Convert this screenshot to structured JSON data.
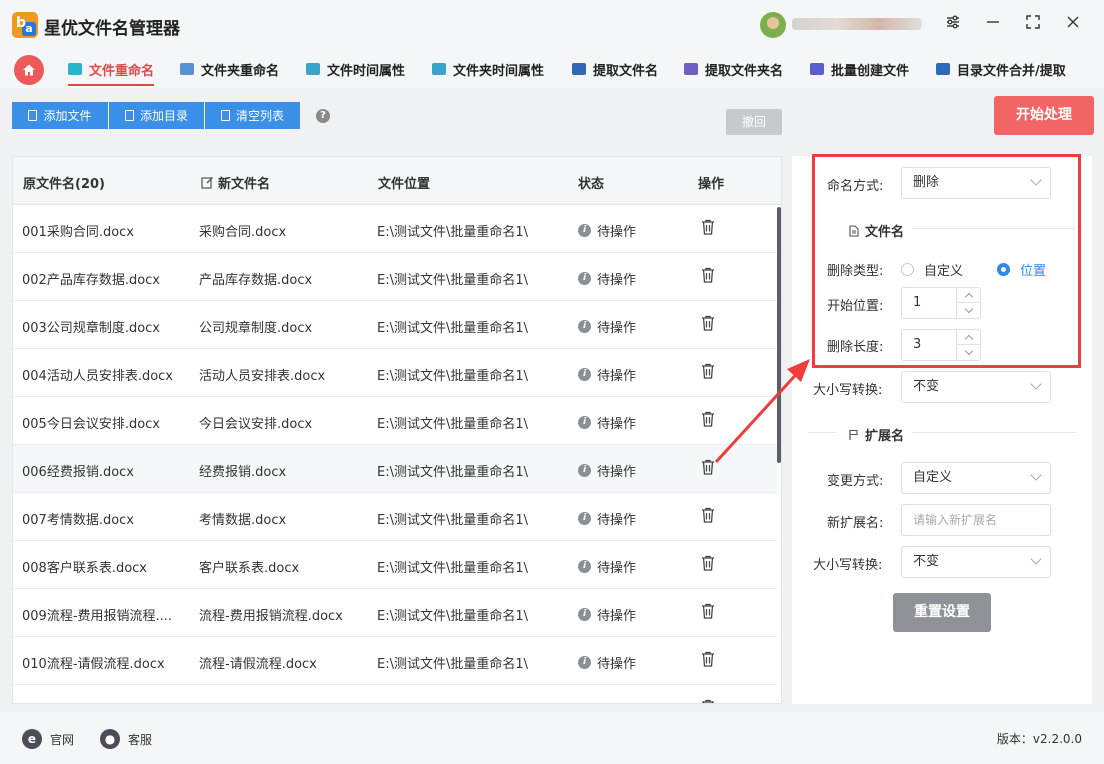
{
  "app": {
    "title": "星优文件名管理器",
    "logo_text": "b",
    "logo_sub": "a"
  },
  "window_controls": {
    "settings": "⚙",
    "minimize": "—",
    "maximize": "⛶",
    "close": "✕"
  },
  "tabs": [
    {
      "label": "文件重命名",
      "active": true,
      "icon_color": "#2ab3c9"
    },
    {
      "label": "文件夹重命名",
      "active": false,
      "icon_color": "#5b8fd6"
    },
    {
      "label": "文件时间属性",
      "active": false,
      "icon_color": "#3aa3c9"
    },
    {
      "label": "文件夹时间属性",
      "active": false,
      "icon_color": "#3aa3c9"
    },
    {
      "label": "提取文件名",
      "active": false,
      "icon_color": "#3567b5"
    },
    {
      "label": "提取文件夹名",
      "active": false,
      "icon_color": "#6d5fc2"
    },
    {
      "label": "批量创建文件",
      "active": false,
      "icon_color": "#5a5fd0"
    },
    {
      "label": "目录文件合并/提取",
      "active": false,
      "icon_color": "#2e6bb8"
    }
  ],
  "toolbar": {
    "add_file": "添加文件",
    "add_dir": "添加目录",
    "clear_list": "清空列表",
    "help": "?",
    "undo": "撤回",
    "start": "开始处理"
  },
  "table": {
    "headers": {
      "original": "原文件名(20)",
      "new": "新文件名",
      "location": "文件位置",
      "status": "状态",
      "action": "操作"
    },
    "rows": [
      {
        "original": "001采购合同.docx",
        "new": "采购合同.docx",
        "location": "E:\\测试文件\\批量重命名1\\",
        "status": "待操作"
      },
      {
        "original": "002产品库存数据.docx",
        "new": "产品库存数据.docx",
        "location": "E:\\测试文件\\批量重命名1\\",
        "status": "待操作"
      },
      {
        "original": "003公司规章制度.docx",
        "new": "公司规章制度.docx",
        "location": "E:\\测试文件\\批量重命名1\\",
        "status": "待操作"
      },
      {
        "original": "004活动人员安排表.docx",
        "new": "活动人员安排表.docx",
        "location": "E:\\测试文件\\批量重命名1\\",
        "status": "待操作"
      },
      {
        "original": "005今日会议安排.docx",
        "new": "今日会议安排.docx",
        "location": "E:\\测试文件\\批量重命名1\\",
        "status": "待操作"
      },
      {
        "original": "006经费报销.docx",
        "new": "经费报销.docx",
        "location": "E:\\测试文件\\批量重命名1\\",
        "status": "待操作"
      },
      {
        "original": "007考情数据.docx",
        "new": "考情数据.docx",
        "location": "E:\\测试文件\\批量重命名1\\",
        "status": "待操作"
      },
      {
        "original": "008客户联系表.docx",
        "new": "客户联系表.docx",
        "location": "E:\\测试文件\\批量重命名1\\",
        "status": "待操作"
      },
      {
        "original": "009流程-费用报销流程....",
        "new": "流程-费用报销流程.docx",
        "location": "E:\\测试文件\\批量重命名1\\",
        "status": "待操作"
      },
      {
        "original": "010流程-请假流程.docx",
        "new": "流程-请假流程.docx",
        "location": "E:\\测试文件\\批量重命名1\\",
        "status": "待操作"
      }
    ]
  },
  "panel": {
    "naming_mode_label": "命名方式:",
    "naming_mode_value": "删除",
    "filename_section": "文件名",
    "delete_type_label": "删除类型:",
    "delete_type_options": [
      "自定义",
      "位置"
    ],
    "delete_type_selected": "位置",
    "start_pos_label": "开始位置:",
    "start_pos_value": "1",
    "delete_len_label": "删除长度:",
    "delete_len_value": "3",
    "case_label": "大小写转换:",
    "case_value": "不变",
    "ext_section": "扩展名",
    "change_mode_label": "变更方式:",
    "change_mode_value": "自定义",
    "new_ext_label": "新扩展名:",
    "new_ext_placeholder": "请输入新扩展名",
    "ext_case_label": "大小写转换:",
    "ext_case_value": "不变",
    "reset": "重置设置"
  },
  "footer": {
    "website": "官网",
    "support": "客服",
    "version": "版本：v2.2.0.0"
  },
  "colors": {
    "accent_red": "#e04848",
    "primary_blue": "#3a8fe6",
    "highlight_box": "#ef3d3d"
  }
}
